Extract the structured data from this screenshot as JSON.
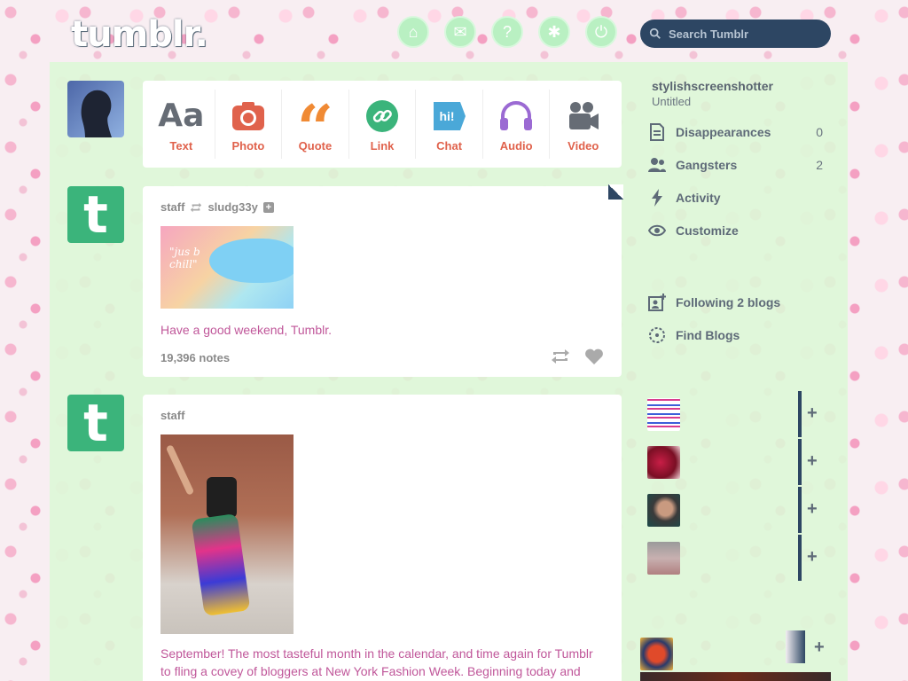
{
  "header": {
    "logo": "tumblr.",
    "nav": [
      {
        "name": "dashboard-home",
        "icon": "home-icon",
        "glyph": "⌂"
      },
      {
        "name": "messages",
        "icon": "envelope-icon",
        "glyph": "✉"
      },
      {
        "name": "explore",
        "icon": "compass-icon",
        "glyph": "?"
      },
      {
        "name": "account",
        "icon": "gear-icon",
        "glyph": "✱"
      },
      {
        "name": "power",
        "icon": "power-icon",
        "glyph": "⏻"
      }
    ],
    "search_placeholder": "Search Tumblr"
  },
  "post_types": [
    {
      "label": "Text",
      "color": "#666c75"
    },
    {
      "label": "Photo",
      "color": "#e0624c"
    },
    {
      "label": "Quote",
      "color": "#f08a34"
    },
    {
      "label": "Link",
      "color": "#3bb47b"
    },
    {
      "label": "Chat",
      "color": "#4aa8d8"
    },
    {
      "label": "Audio",
      "color": "#9b6ad3"
    },
    {
      "label": "Video",
      "color": "#666c75"
    }
  ],
  "posts": [
    {
      "author": "staff",
      "reblogged_from": "sludg33y",
      "image_text": "\"jus b chill\"",
      "caption": "Have a good weekend, Tumblr.",
      "notes": "19,396 notes"
    },
    {
      "author": "staff",
      "caption": "September! The most tasteful month in the calendar, and time again for Tumblr to fling a covey of bloggers at New York Fashion Week. Beginning today and"
    }
  ],
  "sidebar": {
    "username": "stylishscreenshotter",
    "subtitle": "Untitled",
    "items": [
      {
        "label": "Disappearances",
        "count": "0"
      },
      {
        "label": "Gangsters",
        "count": "2"
      },
      {
        "label": "Activity",
        "count": ""
      },
      {
        "label": "Customize",
        "count": ""
      }
    ],
    "following": "Following 2 blogs",
    "find_blogs": "Find Blogs"
  },
  "colors": {
    "accent_dark": "#2d4663",
    "link_pink": "#c0579a",
    "tumblr_green": "#3bb47b"
  }
}
